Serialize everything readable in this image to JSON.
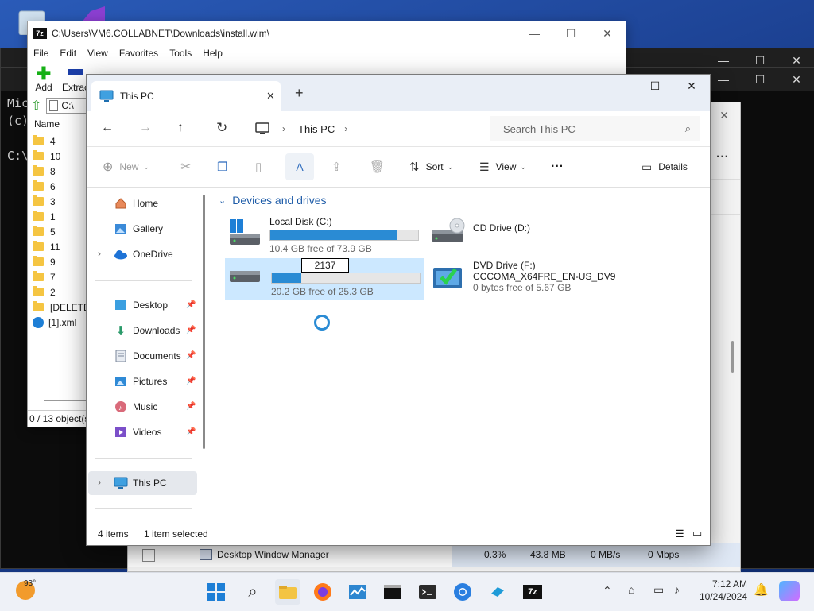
{
  "console": {
    "lines": [
      "Mic",
      "(c)",
      "",
      "C:\\"
    ]
  },
  "sevenzip": {
    "title": "C:\\Users\\VM6.COLLABNET\\Downloads\\install.wim\\",
    "menu": [
      "File",
      "Edit",
      "View",
      "Favorites",
      "Tools",
      "Help"
    ],
    "toolbar": [
      "Add",
      "Extrac"
    ],
    "path_value": "C:\\",
    "column_name": "Name",
    "items": [
      "4",
      "10",
      "8",
      "6",
      "3",
      "1",
      "5",
      "11",
      "9",
      "7",
      "2",
      "[DELETED",
      "[1].xml"
    ],
    "status": "0 / 13 object(s"
  },
  "taskmgr": {
    "row_name": "Desktop Window Manager",
    "row_cpu": "0.3%",
    "row_mem": "43.8 MB",
    "row_disk": "0 MB/s",
    "row_net": "0 Mbps"
  },
  "explorer": {
    "tab_title": "This PC",
    "breadcrumb": "This PC",
    "search_placeholder": "Search This PC",
    "commands": {
      "new": "New",
      "sort": "Sort",
      "view": "View",
      "details": "Details"
    },
    "nav": {
      "quick": [
        "Home",
        "Gallery",
        "OneDrive"
      ],
      "pinned": [
        "Desktop",
        "Downloads",
        "Documents",
        "Pictures",
        "Music",
        "Videos"
      ],
      "this_pc": "This PC"
    },
    "section_title": "Devices and drives",
    "drives": [
      {
        "name": "Local Disk (C:)",
        "free": "10.4 GB free of 73.9 GB",
        "used_fraction": 0.86
      },
      {
        "name": "CD Drive (D:)"
      },
      {
        "name": "2137",
        "free": "20.2 GB free of 25.3 GB",
        "used_fraction": 0.2
      },
      {
        "name": "DVD Drive (F:)",
        "label": "CCCOMA_X64FRE_EN-US_DV9",
        "free": "0 bytes free of 5.67 GB"
      }
    ],
    "status_items": "4 items",
    "status_selected": "1 item selected"
  },
  "taskbar": {
    "weather_temp": "93°",
    "time": "7:12 AM",
    "date": "10/24/2024"
  },
  "colors": {
    "accent": "#2a8bd4",
    "selection": "#cce8ff",
    "console_bg": "#0c0c0c"
  }
}
